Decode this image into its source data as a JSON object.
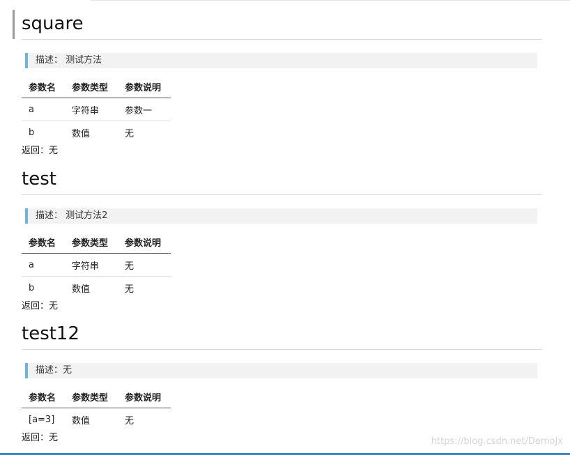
{
  "sections": [
    {
      "title": "square",
      "description": "描述： 测试方法",
      "headers": [
        "参数名",
        "参数类型",
        "参数说明"
      ],
      "rows": [
        [
          "a",
          "字符串",
          "参数一"
        ],
        [
          "b",
          "数值",
          "无"
        ]
      ],
      "returns": "返回：无"
    },
    {
      "title": "test",
      "description": "描述： 测试方法2",
      "headers": [
        "参数名",
        "参数类型",
        "参数说明"
      ],
      "rows": [
        [
          "a",
          "字符串",
          "无"
        ],
        [
          "b",
          "数值",
          "无"
        ]
      ],
      "returns": "返回：无"
    },
    {
      "title": "test12",
      "description": "描述：无",
      "headers": [
        "参数名",
        "参数类型",
        "参数说明"
      ],
      "rows": [
        [
          "[a=3]",
          "数值",
          "无"
        ]
      ],
      "returns": "返回：无"
    }
  ],
  "watermark": "https://blog.csdn.net/DemoJx",
  "colors": {
    "accent": "#6fb3d9",
    "bottom_bar": "#3a86c4"
  }
}
